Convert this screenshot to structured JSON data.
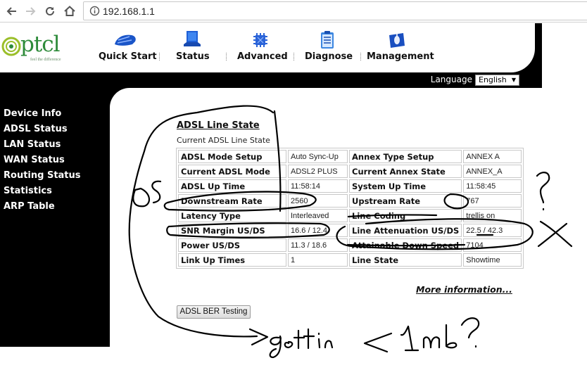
{
  "browser": {
    "url": "192.168.1.1",
    "icons": [
      "back-arrow-icon",
      "forward-arrow-icon",
      "reload-icon",
      "home-icon",
      "info-icon"
    ]
  },
  "logo": {
    "wordmark": "ptcl",
    "tagline": "feel the difference",
    "colors": {
      "green": "#2e8b3a",
      "lime": "#9bbf2a"
    }
  },
  "topnav": [
    {
      "label": "Quick Start",
      "icon": "quick-start-icon"
    },
    {
      "label": "Status",
      "icon": "laptop-icon"
    },
    {
      "label": "Advanced",
      "icon": "chip-icon"
    },
    {
      "label": "Diagnose",
      "icon": "clipboard-icon"
    },
    {
      "label": "Management",
      "icon": "management-icon"
    }
  ],
  "language": {
    "label": "Language",
    "selected": "English"
  },
  "sidebar": {
    "items": [
      {
        "label": "Device Info"
      },
      {
        "label": "ADSL Status"
      },
      {
        "label": "LAN Status"
      },
      {
        "label": "WAN Status"
      },
      {
        "label": "Routing Status"
      },
      {
        "label": "Statistics"
      },
      {
        "label": "ARP Table"
      }
    ]
  },
  "content": {
    "title": "ADSL Line State",
    "subtitle": "Current ADSL Line State",
    "rows": [
      {
        "k1": "ADSL Mode Setup",
        "v1": "Auto Sync-Up",
        "k2": "Annex Type Setup",
        "v2": "ANNEX A"
      },
      {
        "k1": "Current ADSL Mode",
        "v1": "ADSL2 PLUS",
        "k2": "Current Annex State",
        "v2": "ANNEX_A"
      },
      {
        "k1": "ADSL Up Time",
        "v1": "11:58:14",
        "k2": "System Up Time",
        "v2": "11:58:45"
      },
      {
        "k1": "Downstream Rate",
        "v1": "2560",
        "k2": "Upstream Rate",
        "v2": "767"
      },
      {
        "k1": "Latency Type",
        "v1": "Interleaved",
        "k2": "Line Coding",
        "v2": "trellis on"
      },
      {
        "k1": "SNR Margin US/DS",
        "v1": "16.6 / 12.4",
        "k2": "Line Attenuation US/DS",
        "v2": "22.5 / 42.3"
      },
      {
        "k1": "Power US/DS",
        "v1": "11.3 / 18.6",
        "k2": "Attainable Down Speed",
        "v2": "7104"
      },
      {
        "k1": "Link Up Times",
        "v1": "1",
        "k2": "Line State",
        "v2": "Showtime"
      }
    ],
    "more_link": "More information...",
    "ber_button": "ADSL BER Testing"
  },
  "annotations": {
    "ds": "DS",
    "question_right": "?",
    "x_mark": "X",
    "bottom_note": "gettin <1mb?"
  }
}
